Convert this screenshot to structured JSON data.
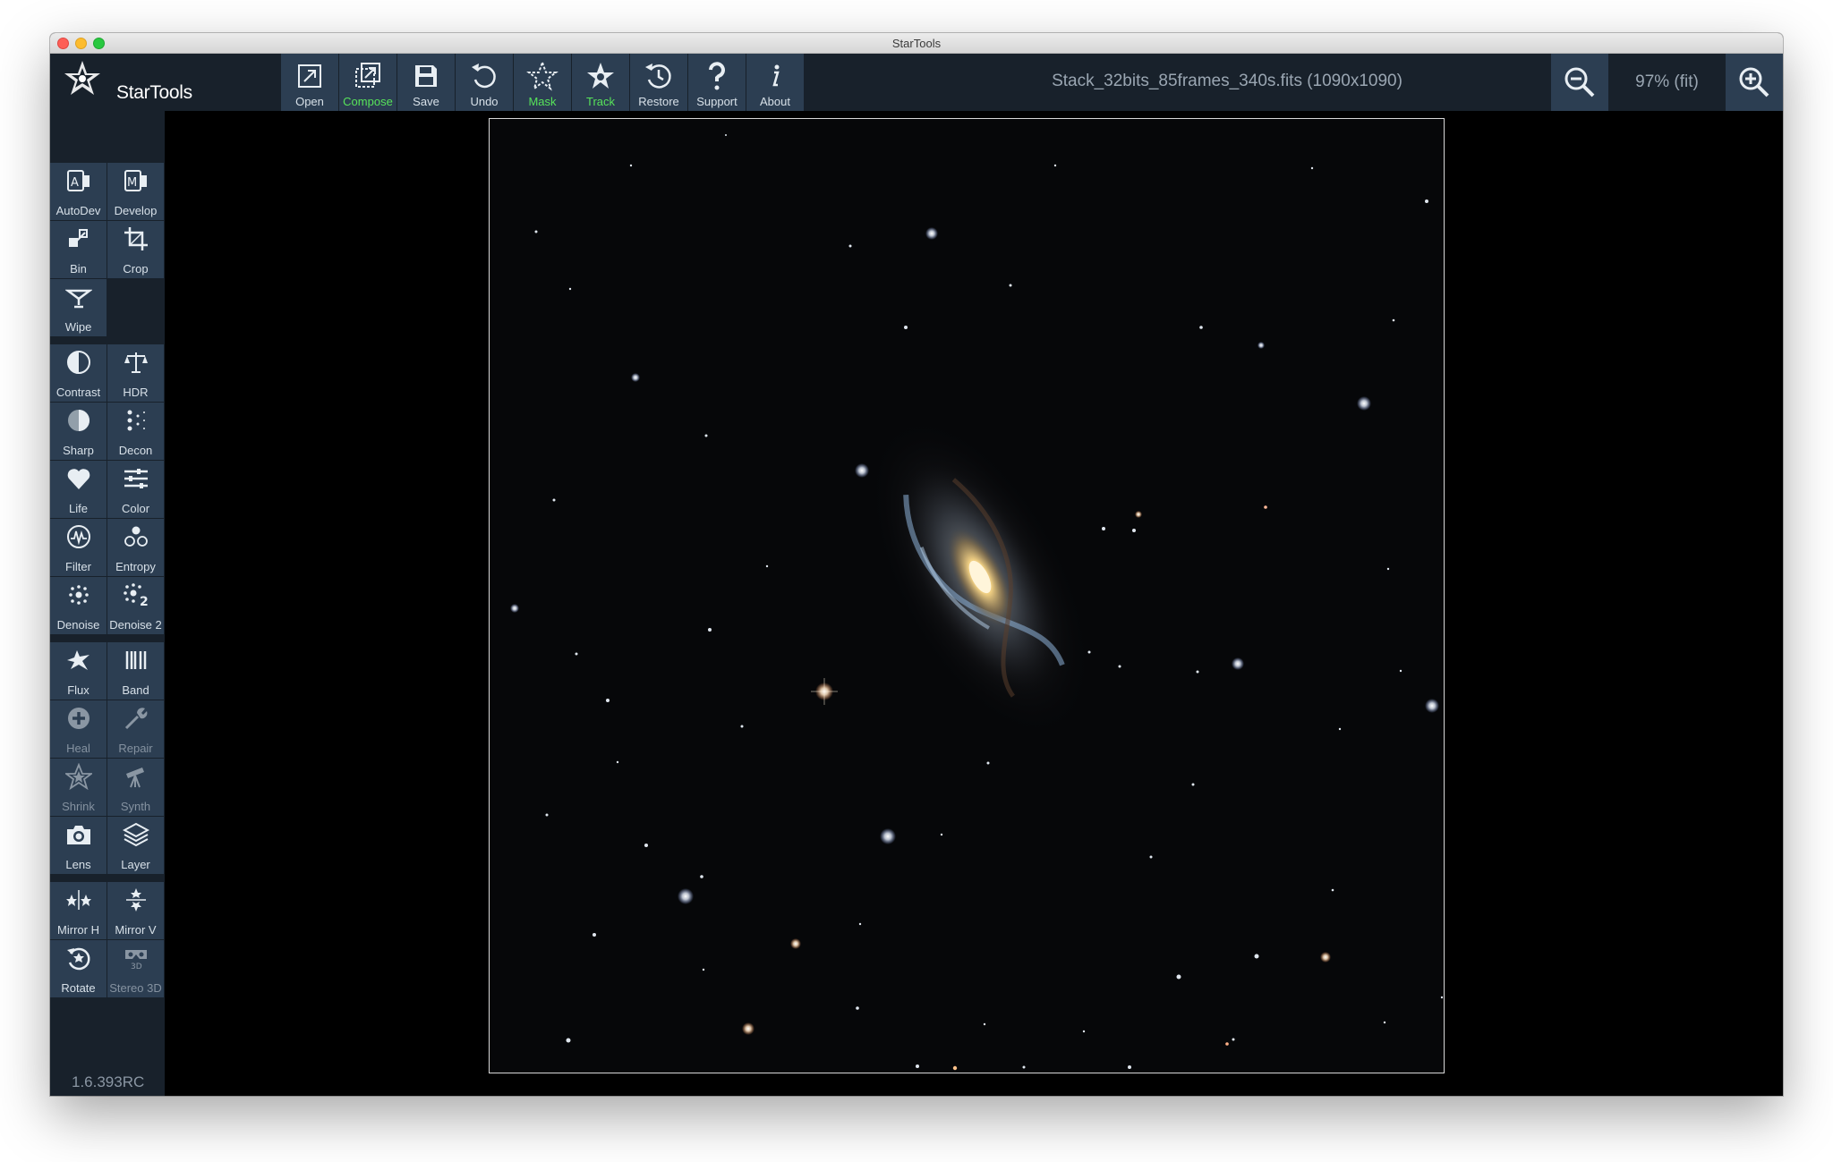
{
  "window": {
    "title": "StarTools"
  },
  "app": {
    "logo_text": "StarTools",
    "version": "1.6.393RC"
  },
  "toolbar": [
    {
      "label": "Open",
      "icon": "open-icon",
      "active": false
    },
    {
      "label": "Compose",
      "icon": "compose-icon",
      "active": true
    },
    {
      "label": "Save",
      "icon": "save-icon",
      "active": false
    },
    {
      "label": "Undo",
      "icon": "undo-icon",
      "active": false
    },
    {
      "label": "Mask",
      "icon": "mask-icon",
      "active": true
    },
    {
      "label": "Track",
      "icon": "track-icon",
      "active": true
    },
    {
      "label": "Restore",
      "icon": "restore-icon",
      "active": false
    },
    {
      "label": "Support",
      "icon": "support-icon",
      "active": false
    },
    {
      "label": "About",
      "icon": "about-icon",
      "active": false
    }
  ],
  "document": {
    "filename": "Stack_32bits_85frames_340s.fits (1090x1090)"
  },
  "zoom": {
    "level": "97% (fit)"
  },
  "tools": [
    {
      "label": "AutoDev",
      "icon": "autodev-icon"
    },
    {
      "label": "Develop",
      "icon": "develop-icon"
    },
    {
      "label": "Bin",
      "icon": "bin-icon"
    },
    {
      "label": "Crop",
      "icon": "crop-icon"
    },
    {
      "label": "Wipe",
      "icon": "wipe-icon"
    },
    {
      "label": "Contrast",
      "icon": "contrast-icon"
    },
    {
      "label": "HDR",
      "icon": "hdr-icon"
    },
    {
      "label": "Sharp",
      "icon": "sharp-icon"
    },
    {
      "label": "Decon",
      "icon": "decon-icon"
    },
    {
      "label": "Life",
      "icon": "life-icon"
    },
    {
      "label": "Color",
      "icon": "color-icon"
    },
    {
      "label": "Filter",
      "icon": "filter-icon"
    },
    {
      "label": "Entropy",
      "icon": "entropy-icon"
    },
    {
      "label": "Denoise",
      "icon": "denoise-icon"
    },
    {
      "label": "Denoise 2",
      "icon": "denoise2-icon"
    },
    {
      "label": "Flux",
      "icon": "flux-icon"
    },
    {
      "label": "Band",
      "icon": "band-icon"
    },
    {
      "label": "Heal",
      "icon": "heal-icon",
      "disabled": true
    },
    {
      "label": "Repair",
      "icon": "repair-icon",
      "disabled": true
    },
    {
      "label": "Shrink",
      "icon": "shrink-icon",
      "disabled": true
    },
    {
      "label": "Synth",
      "icon": "synth-icon",
      "disabled": true
    },
    {
      "label": "Lens",
      "icon": "lens-icon"
    },
    {
      "label": "Layer",
      "icon": "layer-icon"
    },
    {
      "label": "Mirror H",
      "icon": "mirror-h-icon"
    },
    {
      "label": "Mirror V",
      "icon": "mirror-v-icon"
    },
    {
      "label": "Rotate",
      "icon": "rotate-icon"
    },
    {
      "label": "Stereo 3D",
      "icon": "stereo-3d-icon",
      "disabled": true
    }
  ],
  "colors": {
    "panel": "#18212b",
    "button": "#2c3e52",
    "label": "#d7e0e8",
    "active_label": "#57e35a"
  }
}
